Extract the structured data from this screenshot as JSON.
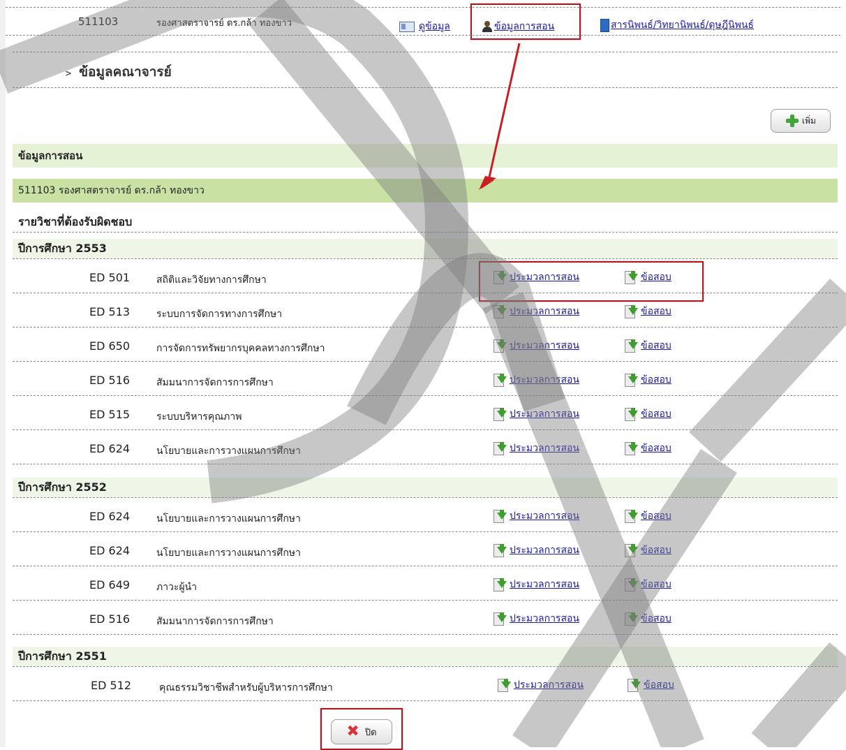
{
  "top_row": {
    "id": "511103",
    "name": "รองศาสตราจารย์ ดร.กล้า ทองขาว",
    "links": {
      "view": "ดูข้อมูล",
      "teaching": "ข้อมูลการสอน",
      "thesis": "สารนิพนธ์/วิทยานิพนธ์/ดุษฎีนิพนธ์"
    },
    "icons": {
      "view": "id-card-icon",
      "teaching": "person-icon",
      "thesis": "book-icon"
    }
  },
  "section_title": "ข้อมูลคณาจารย์",
  "add_button": "เพิ่ม",
  "teaching_header": "ข้อมูลการสอน",
  "person_bar": "511103  รองศาสตราจารย์ ดร.กล้า ทองขาว",
  "responsible_label": "รายวิชาที่ต้องรับผิดชอบ",
  "link_labels": {
    "eval": "ประมวลการสอน",
    "exam": "ข้อสอบ"
  },
  "years": [
    {
      "label": "ปีการศึกษา  2553",
      "courses": [
        {
          "code": "ED 501",
          "name": "สถิติและวิจัยทางการศึกษา"
        },
        {
          "code": "ED 513",
          "name": "ระบบการจัดการทางการศึกษา"
        },
        {
          "code": "ED 650",
          "name": "การจัดการทรัพยากรบุคคลทางการศึกษา"
        },
        {
          "code": "ED 516",
          "name": "สัมมนาการจัดการการศึกษา"
        },
        {
          "code": "ED 515",
          "name": "ระบบบริหารคุณภาพ"
        },
        {
          "code": "ED 624",
          "name": "นโยบายและการวางแผนการศึกษา"
        }
      ]
    },
    {
      "label": "ปีการศึกษา  2552",
      "courses": [
        {
          "code": "ED 624",
          "name": "นโยบายและการวางแผนการศึกษา"
        },
        {
          "code": "ED 624",
          "name": "นโยบายและการวางแผนการศึกษา"
        },
        {
          "code": "ED 649",
          "name": "ภาวะผู้นำ"
        },
        {
          "code": "ED 516",
          "name": "สัมมนาการจัดการการศึกษา"
        }
      ]
    },
    {
      "label": "ปีการศึกษา  2551",
      "courses": [
        {
          "code": "ED 512",
          "name": "คุณธรรมวิชาชีพสำหรับผู้บริหารการศึกษา"
        }
      ]
    }
  ],
  "close_button": "ปิด",
  "colors": {
    "highlight": "#b0161f",
    "band_light": "#e6f2d6",
    "band_dark": "#c9e2a4",
    "link": "#1a1aa6"
  }
}
